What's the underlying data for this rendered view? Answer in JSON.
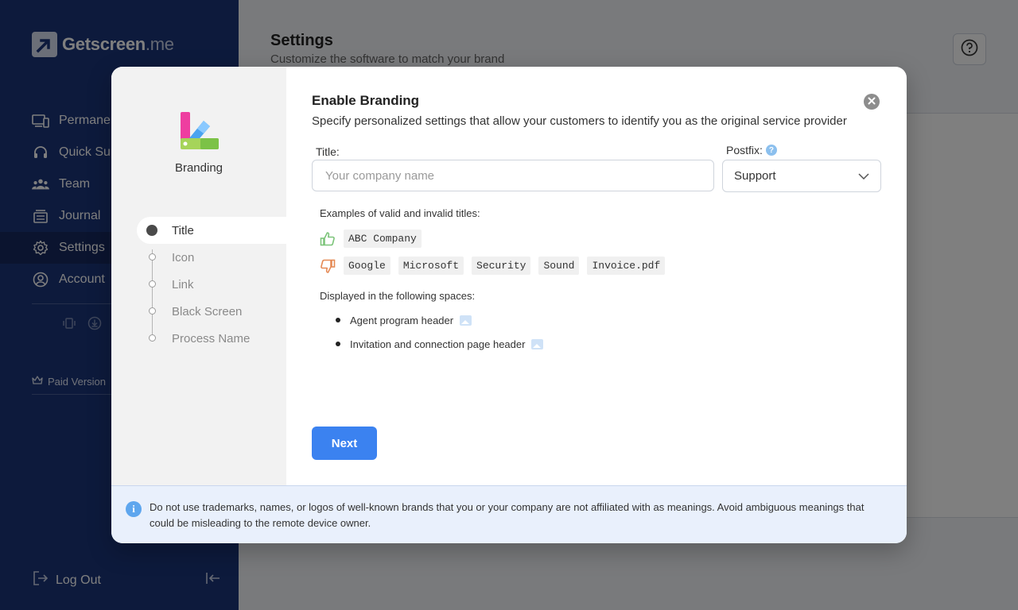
{
  "app": {
    "logo_main": "Getscreen",
    "logo_suffix": ".me"
  },
  "sidebar": {
    "items": [
      {
        "label": "Permanent",
        "icon": "devices-icon"
      },
      {
        "label": "Quick Sup",
        "icon": "headset-icon"
      },
      {
        "label": "Team",
        "icon": "team-icon"
      },
      {
        "label": "Journal",
        "icon": "journal-icon"
      },
      {
        "label": "Settings",
        "icon": "gear-icon",
        "active": true
      },
      {
        "label": "Account",
        "icon": "account-icon"
      }
    ],
    "paid_label": "Paid Version",
    "logout_label": "Log Out"
  },
  "page": {
    "title": "Settings",
    "subtitle": "Customize the software to match your brand"
  },
  "modal": {
    "left": {
      "brand_label": "Branding",
      "steps": [
        "Title",
        "Icon",
        "Link",
        "Black Screen",
        "Process Name"
      ],
      "active_step": "Title"
    },
    "title": "Enable Branding",
    "description": "Specify personalized settings that allow your customers to identify you as the original service provider",
    "title_field": {
      "label": "Title:",
      "placeholder": "Your company name",
      "value": ""
    },
    "postfix": {
      "label": "Postfix:",
      "value": "Support"
    },
    "examples_label": "Examples of valid and invalid titles:",
    "valid_examples": [
      "ABC Company"
    ],
    "invalid_examples": [
      "Google",
      "Microsoft",
      "Security",
      "Sound",
      "Invoice.pdf"
    ],
    "displayed_label": "Displayed in the following spaces:",
    "displayed_items": [
      "Agent program header",
      "Invitation and connection page header"
    ],
    "next_label": "Next",
    "notice": "Do not use trademarks, names, or logos of well-known brands that you or your company are not affiliated with as meanings. Avoid ambiguous meanings that could be misleading to the remote device owner."
  },
  "colors": {
    "sidebar_bg": "#1b3478",
    "accent": "#3b82f0",
    "valid_green": "#7cc47a",
    "invalid_orange": "#e58a55"
  }
}
